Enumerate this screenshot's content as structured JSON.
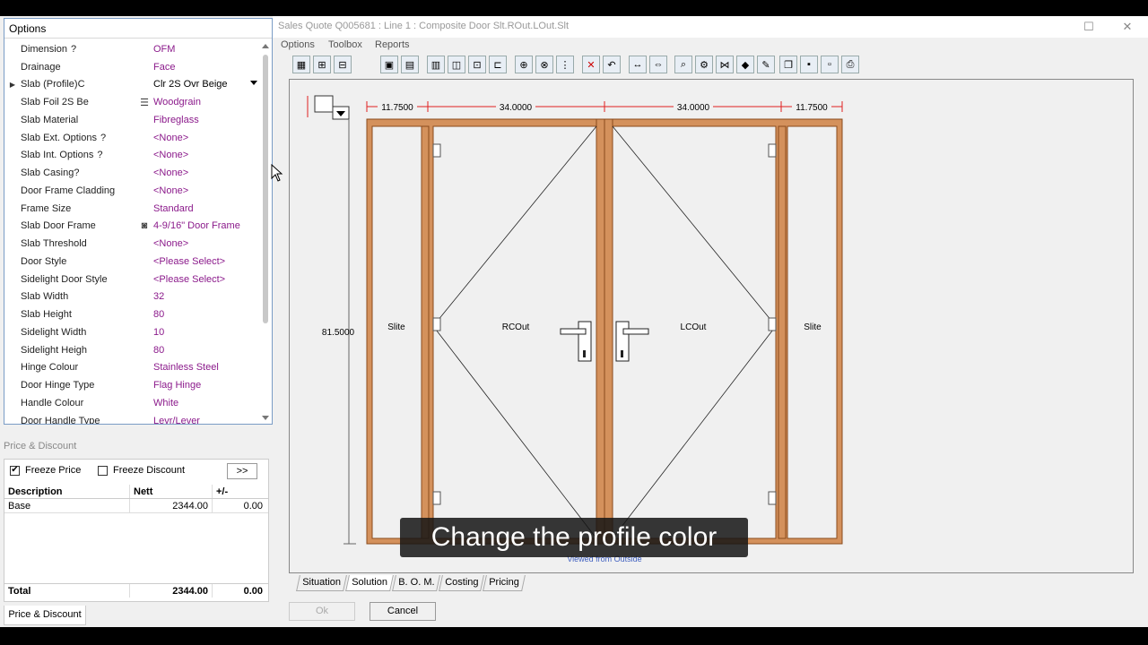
{
  "window": {
    "title": "Sales Quote Q005681  : Line   1 : Composite Door Slt.ROut.LOut.Slt"
  },
  "menu": [
    "Options",
    "Toolbox",
    "Reports"
  ],
  "options": {
    "title": "Options",
    "rows": [
      {
        "label": "Dimension",
        "q": "?",
        "value": "OFM"
      },
      {
        "label": "Drainage",
        "value": "Face"
      },
      {
        "label": "Slab (Profile)C",
        "value": "Clr 2S Ovr Beige",
        "selected": true
      },
      {
        "label": "Slab Foil 2S Be",
        "value": "Woodgrain"
      },
      {
        "label": "Slab Material",
        "value": "Fibreglass"
      },
      {
        "label": "Slab Ext. Options",
        "q": "?",
        "value": "<None>"
      },
      {
        "label": "Slab Int. Options",
        "q": "?",
        "value": "<None>"
      },
      {
        "label": "Slab Casing?",
        "value": "<None>"
      },
      {
        "label": "Door Frame Cladding",
        "value": "<None>"
      },
      {
        "label": "Frame Size",
        "value": "Standard"
      },
      {
        "label": "Slab Door Frame",
        "value": "4-9/16\" Door Frame"
      },
      {
        "label": "Slab Threshold",
        "value": "<None>"
      },
      {
        "label": "Door Style",
        "value": "<Please Select>"
      },
      {
        "label": "Sidelight Door Style",
        "value": "<Please Select>"
      },
      {
        "label": "Slab Width",
        "value": "32"
      },
      {
        "label": "Slab Height",
        "value": "80"
      },
      {
        "label": "Sidelight Width",
        "value": "10"
      },
      {
        "label": "Sidelight Heigh",
        "value": "80"
      },
      {
        "label": "Hinge Colour",
        "value": "Stainless Steel"
      },
      {
        "label": "Door Hinge Type",
        "value": "Flag Hinge"
      },
      {
        "label": "Handle Colour",
        "value": "White"
      },
      {
        "label": "Door Handle Type",
        "value": "Levr/Lever"
      }
    ]
  },
  "price": {
    "section_title": "Price & Discount",
    "freeze_price": "Freeze Price",
    "freeze_discount": "Freeze Discount",
    "more": ">>",
    "headers": [
      "Description",
      "Nett",
      "+/-"
    ],
    "rows": [
      {
        "desc": "Base",
        "nett": "2344.00",
        "pm": "0.00"
      }
    ],
    "total": {
      "desc": "Total",
      "nett": "2344.00",
      "pm": "0.00"
    },
    "tab": "Price & Discount"
  },
  "drawing": {
    "dims_top": [
      "11.7500",
      "34.0000",
      "34.0000",
      "11.7500"
    ],
    "height": "81.5000",
    "panels": [
      "Slite",
      "RCOut",
      "LCOut",
      "Slite"
    ],
    "viewed": "Viewed from Outside"
  },
  "tabs": [
    "Situation",
    "Solution",
    "B. O. M.",
    "Costing",
    "Pricing"
  ],
  "buttons": {
    "ok": "Ok",
    "cancel": "Cancel"
  },
  "caption": "Change the profile color",
  "colors": {
    "frame": "#d4915c",
    "frame_edge": "#8a4a1c",
    "dim_red": "#e02020",
    "value_purple": "#8b1a8b"
  }
}
